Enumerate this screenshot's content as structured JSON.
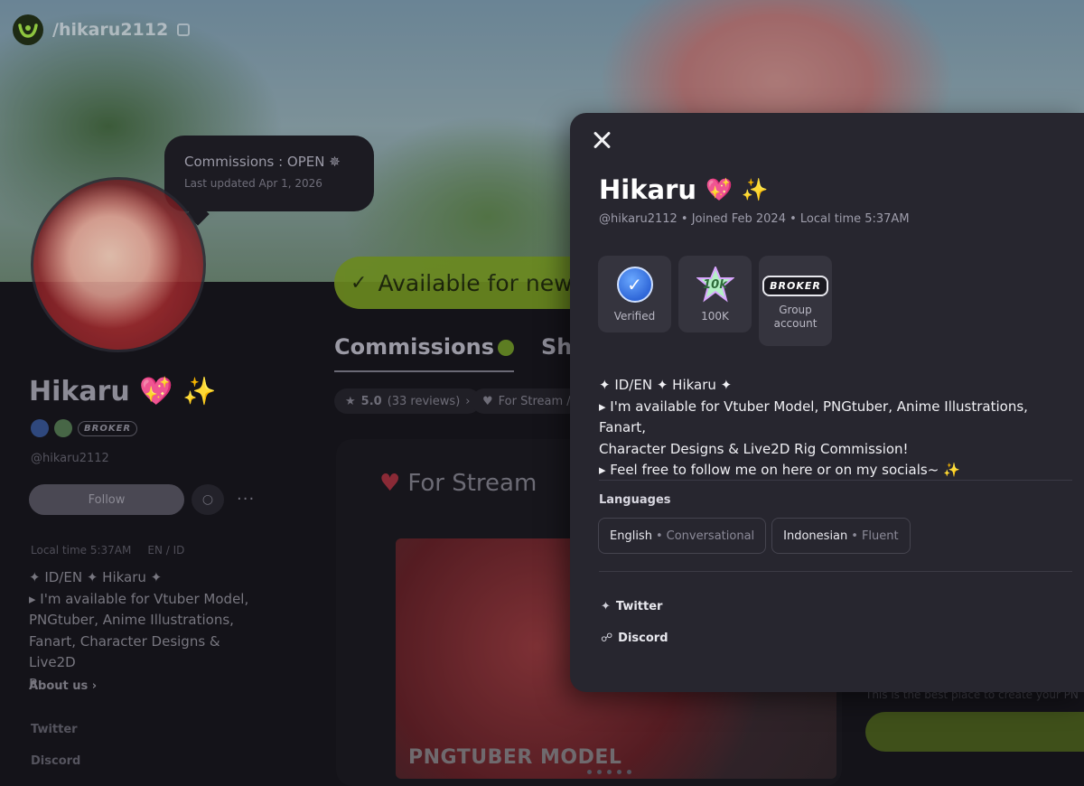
{
  "header": {
    "handle": "/hikaru2112"
  },
  "status_bubble": {
    "title": "Commissions : OPEN ✵",
    "updated": "Last updated Apr 1, 2026"
  },
  "availability": {
    "label": "Available for new",
    "check": "✓"
  },
  "profile": {
    "name": "Hikaru",
    "name_emojis": "💖 ✨",
    "handle": "@hikaru2112",
    "broker_badge": "BROKER",
    "follow_label": "Follow",
    "chat_icon": "chat-icon",
    "more_label": "···",
    "local_time": "Local time 5:37AM",
    "languages_short": "EN / ID",
    "bio_lines": [
      "✦ ID/EN ✦ Hikaru ✦",
      "▸ I'm available for Vtuber Model,",
      "PNGtuber, Anime Illustrations,",
      "Fanart, Character Designs & Live2D",
      "R..."
    ],
    "about_label": "About us ›",
    "twitter_label": "Twitter",
    "discord_label": "Discord"
  },
  "tabs": [
    {
      "label": "Commissions"
    },
    {
      "label": "Sh"
    }
  ],
  "filters": {
    "rating": "5.0",
    "reviews": "(33 reviews)",
    "stream": "For Stream /"
  },
  "card": {
    "title": "For Stream",
    "image_label": "PNGTUBER MODEL",
    "side_desc": "This is the best place to create your PN"
  },
  "modal": {
    "close_icon": "close-icon",
    "name": "Hikaru",
    "name_emojis": [
      "💖",
      "✨"
    ],
    "meta": "@hikaru2112 • Joined Feb 2024 • Local time 5:37AM",
    "badges": [
      {
        "icon": "verified-icon",
        "label": "Verified"
      },
      {
        "icon": "100k-icon",
        "label": "100K",
        "icon_text": "10k"
      },
      {
        "icon": "broker-icon",
        "label": "Group account",
        "icon_text": "BROKER"
      }
    ],
    "bio": [
      "✦ ID/EN ✦ Hikaru ✦",
      "▸ I'm available for Vtuber Model, PNGtuber, Anime Illustrations, Fanart,",
      "Character Designs & Live2D Rig Commission!",
      "▸ Feel free to follow me on here or on my socials~ ✨"
    ],
    "languages_title": "Languages",
    "languages": [
      {
        "name": "English",
        "level": "Conversational"
      },
      {
        "name": "Indonesian",
        "level": "Fluent"
      }
    ],
    "links": [
      {
        "icon": "twitter-icon",
        "label": "Twitter"
      },
      {
        "icon": "link-icon",
        "label": "Discord"
      }
    ]
  },
  "colors": {
    "accent_green": "#6b8a1f",
    "modal_bg": "#27262f",
    "page_bg": "#18171d"
  }
}
